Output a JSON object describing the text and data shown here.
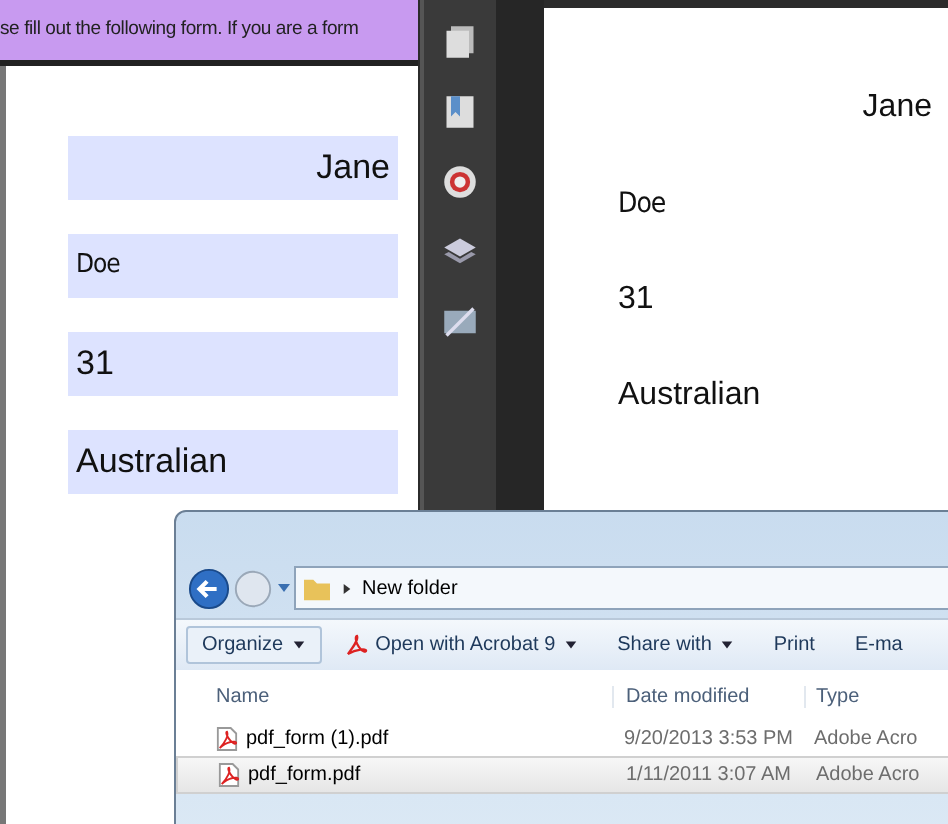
{
  "form_window": {
    "banner": "se fill out the following form. If you are a form",
    "fields": [
      "Jane",
      "Doe",
      "31",
      "Australian"
    ]
  },
  "acrobat_window": {
    "page_values": [
      "Jane",
      "Doe",
      "31",
      "Australian"
    ]
  },
  "explorer_window": {
    "address": {
      "path": "New folder"
    },
    "toolbar": [
      {
        "label": "Organize",
        "kind": "dropdown"
      },
      {
        "label": "Open with Acrobat 9",
        "kind": "pdf-dropdown"
      },
      {
        "label": "Share with",
        "kind": "dropdown"
      },
      {
        "label": "Print",
        "kind": "button"
      },
      {
        "label": "E-ma",
        "kind": "button"
      }
    ],
    "columns": [
      "Name",
      "Date modified",
      "Type"
    ],
    "files": [
      {
        "name": "pdf_form (1).pdf",
        "date": "9/20/2013 3:53 PM",
        "type": "Adobe Acro",
        "selected": false
      },
      {
        "name": "pdf_form.pdf",
        "date": "1/11/2011 3:07 AM",
        "type": "Adobe Acro",
        "selected": true
      }
    ]
  }
}
